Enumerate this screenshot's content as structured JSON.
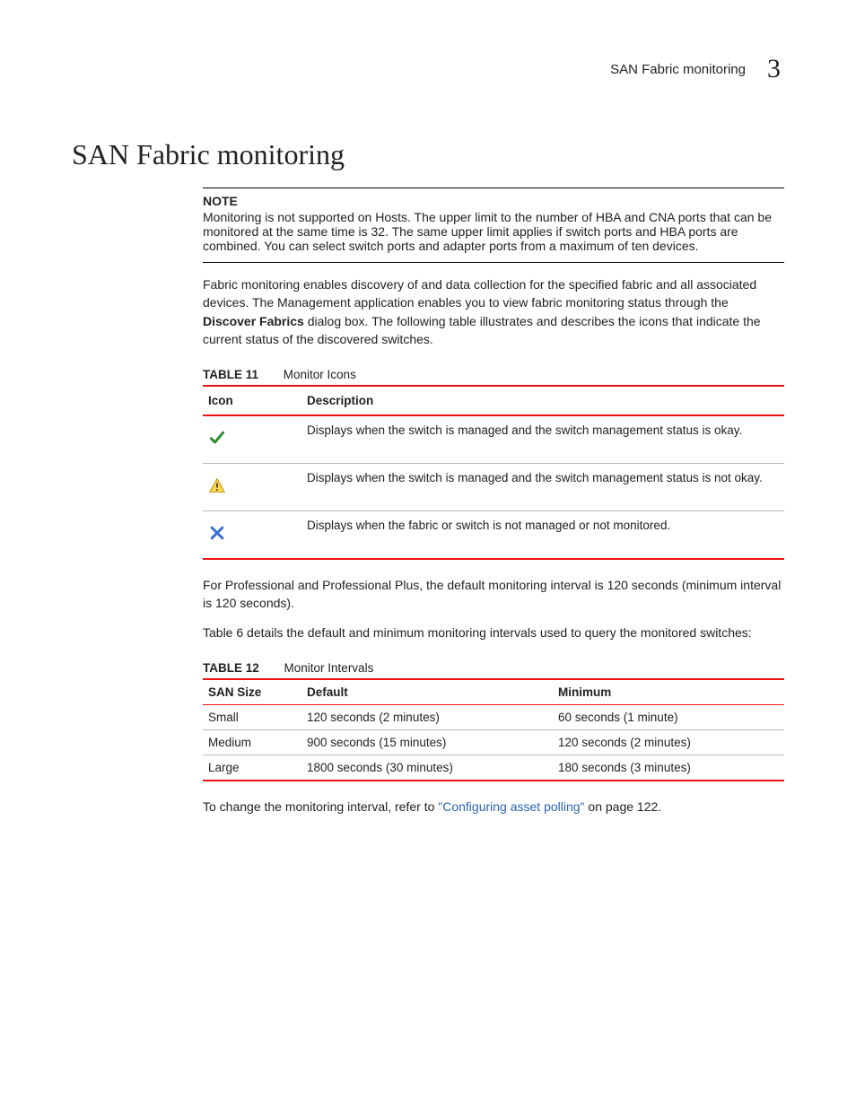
{
  "header": {
    "running_text": "SAN Fabric monitoring",
    "chapter_number": "3"
  },
  "heading": "SAN Fabric monitoring",
  "note": {
    "label": "NOTE",
    "body": "Monitoring is not supported on Hosts. The upper limit to the number of HBA and CNA ports that can be monitored at the same time is 32. The same upper limit applies if switch ports and HBA ports are combined. You can select switch ports and adapter ports from a maximum of ten devices."
  },
  "intro_before_bold": "Fabric monitoring enables discovery of and data collection for the specified fabric and all associated devices. The Management application enables you to view fabric monitoring status through the ",
  "intro_bold": "Discover Fabrics",
  "intro_after_bold": " dialog box. The following table illustrates and describes the icons that indicate the current status of the discovered switches.",
  "table11": {
    "caption_num": "TABLE 11",
    "caption_title": "Monitor Icons",
    "col_icon": "Icon",
    "col_desc": "Description",
    "rows": [
      {
        "icon": "check",
        "desc": "Displays when the switch is managed and the switch management status is okay."
      },
      {
        "icon": "warning",
        "desc": "Displays when the switch is managed and the switch management status is not okay."
      },
      {
        "icon": "cross",
        "desc": "Displays when the fabric or switch is not managed or not monitored."
      }
    ]
  },
  "para_after_t11": "For Professional and Professional Plus, the default monitoring interval is 120 seconds (minimum interval is 120 seconds).",
  "para_table6_ref": "Table 6 details the default and minimum monitoring intervals used to query the monitored switches:",
  "table12": {
    "caption_num": "TABLE 12",
    "caption_title": "Monitor Intervals",
    "col_size": "SAN Size",
    "col_default": "Default",
    "col_min": "Minimum",
    "rows": [
      {
        "size": "Small",
        "default": "120 seconds (2 minutes)",
        "min": "60 seconds (1 minute)"
      },
      {
        "size": "Medium",
        "default": "900 seconds (15 minutes)",
        "min": "120 seconds (2 minutes)"
      },
      {
        "size": "Large",
        "default": "1800 seconds (30 minutes)",
        "min": "180 seconds (3 minutes)"
      }
    ]
  },
  "closing_before_link": "To change the monitoring interval, refer to ",
  "closing_link": "\"Configuring asset polling\"",
  "closing_after_link": " on page 122."
}
